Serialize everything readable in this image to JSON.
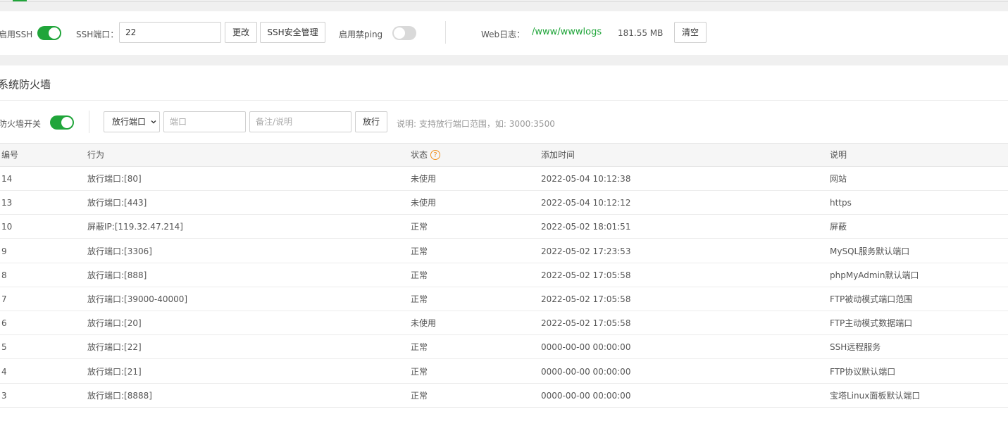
{
  "ssh_bar": {
    "enable_ssh_label": "启用SSH",
    "ssh_port_label": "SSH端口：",
    "ssh_port_value": "22",
    "change_button": "更改",
    "ssh_manage_button": "SSH安全管理",
    "ban_ping_label": "启用禁ping",
    "web_log_label": "Web日志：",
    "web_log_path": "/www/wwwlogs",
    "web_log_size": "181.55 MB",
    "clear_button": "清空",
    "colors": {
      "accent": "#20a53a",
      "toggle_off": "#d9d9d9"
    }
  },
  "firewall": {
    "section_title": "系统防火墙",
    "firewall_switch_label": "防火墙开关",
    "rule_type_selected": "放行端口",
    "port_input_placeholder": "端口",
    "remark_input_placeholder": "备注/说明",
    "allow_button": "放行",
    "hint": "说明: 支持放行端口范围，如: 3000:3500"
  },
  "table": {
    "columns": [
      "编号",
      "行为",
      "状态",
      "添加时间",
      "说明"
    ],
    "rows": [
      [
        "14",
        "放行端口:[80]",
        "未使用",
        "2022-05-04 10:12:38",
        "网站"
      ],
      [
        "13",
        "放行端口:[443]",
        "未使用",
        "2022-05-04 10:12:12",
        "https"
      ],
      [
        "10",
        "屏蔽IP:[119.32.47.214]",
        "正常",
        "2022-05-02 18:01:51",
        "屏蔽"
      ],
      [
        "9",
        "放行端口:[3306]",
        "正常",
        "2022-05-02 17:23:53",
        "MySQL服务默认端口"
      ],
      [
        "8",
        "放行端口:[888]",
        "正常",
        "2022-05-02 17:05:58",
        "phpMyAdmin默认端口"
      ],
      [
        "7",
        "放行端口:[39000-40000]",
        "正常",
        "2022-05-02 17:05:58",
        "FTP被动模式端口范围"
      ],
      [
        "6",
        "放行端口:[20]",
        "未使用",
        "2022-05-02 17:05:58",
        "FTP主动模式数据端口"
      ],
      [
        "5",
        "放行端口:[22]",
        "正常",
        "0000-00-00 00:00:00",
        "SSH远程服务"
      ],
      [
        "4",
        "放行端口:[21]",
        "正常",
        "0000-00-00 00:00:00",
        "FTP协议默认端口"
      ],
      [
        "3",
        "放行端口:[8888]",
        "正常",
        "0000-00-00 00:00:00",
        "宝塔Linux面板默认端口"
      ]
    ]
  }
}
